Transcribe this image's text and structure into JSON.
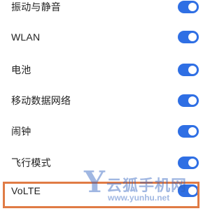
{
  "settings": {
    "items": [
      {
        "label": "振动与静音",
        "toggle": "on"
      },
      {
        "label": "WLAN",
        "toggle": "on"
      },
      {
        "label": "电池",
        "toggle": "on"
      },
      {
        "label": "移动数据网络",
        "toggle": "on"
      },
      {
        "label": "闹钟",
        "toggle": "on"
      },
      {
        "label": "飞行模式",
        "toggle": "on"
      },
      {
        "label": "VoLTE",
        "toggle": "on"
      }
    ]
  },
  "highlight": {
    "target": "VoLTE",
    "color": "#e07b45"
  },
  "watermark": {
    "logo_letter": "Y",
    "title": "云狐手机网",
    "url": "www.yunhu.net"
  },
  "colors": {
    "toggle_on": "#2f6fe4",
    "background": "#ffffff",
    "text": "#1f1f1f"
  }
}
